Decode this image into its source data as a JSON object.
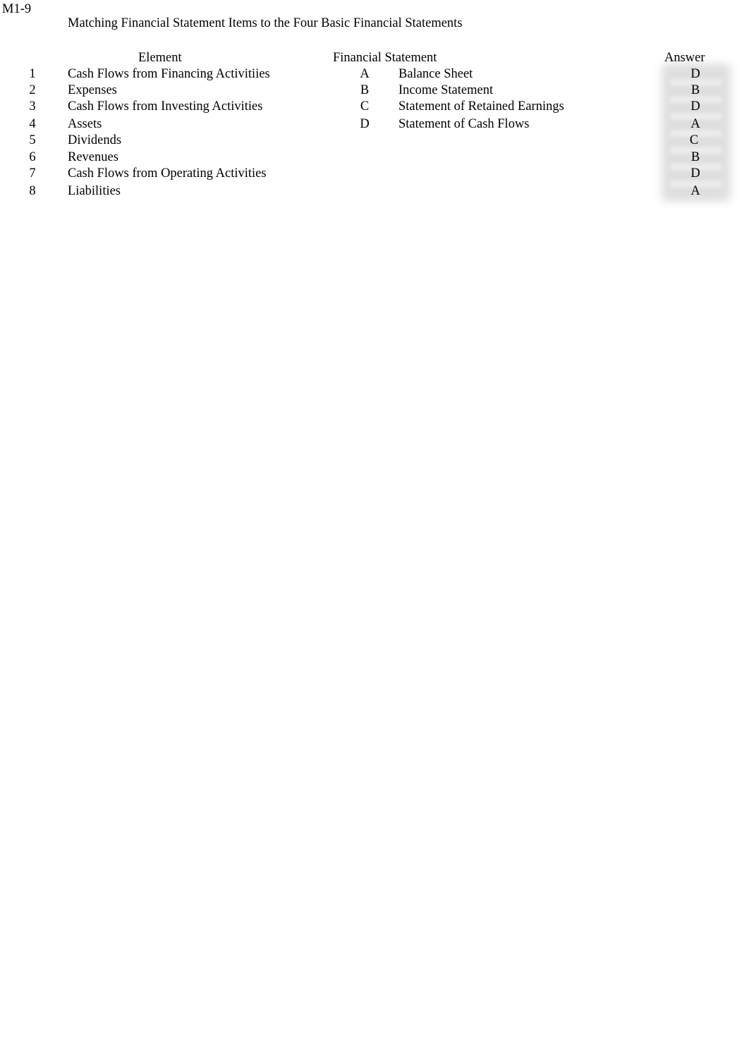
{
  "sheet": {
    "code": "M1-9",
    "title": "Matching Financial Statement Items to the Four Basic Financial Statements",
    "headers": {
      "element": "Element",
      "financial_statement": "Financial Statement",
      "answer": "Answer"
    },
    "rows": [
      {
        "num": "1",
        "element": "Cash Flows from Financing Activitiies",
        "letter": "A",
        "statement": "Balance Sheet",
        "answer": "D"
      },
      {
        "num": "2",
        "element": "Expenses",
        "letter": "B",
        "statement": "Income Statement",
        "answer": "B"
      },
      {
        "num": "3",
        "element": "Cash Flows from Investing Activities",
        "letter": "C",
        "statement": "Statement of Retained Earnings",
        "answer": "D"
      },
      {
        "num": "4",
        "element": "Assets",
        "letter": "D",
        "statement": "Statement of Cash Flows",
        "answer": "A"
      },
      {
        "num": "5",
        "element": "Dividends",
        "letter": "",
        "statement": "",
        "answer": "C"
      },
      {
        "num": "6",
        "element": "Revenues",
        "letter": "",
        "statement": "",
        "answer": "B"
      },
      {
        "num": "7",
        "element": "Cash Flows from Operating Activities",
        "letter": "",
        "statement": "",
        "answer": "D"
      },
      {
        "num": "8",
        "element": "Liabilities",
        "letter": "",
        "statement": "",
        "answer": "A"
      }
    ]
  },
  "colors": {
    "answer_highlight": "#d9d9d9"
  }
}
